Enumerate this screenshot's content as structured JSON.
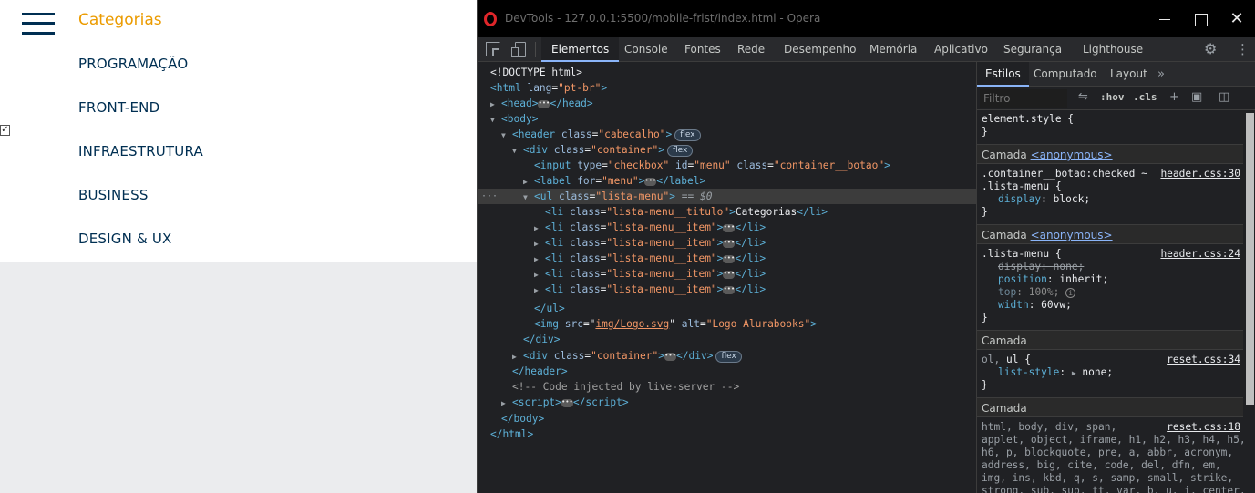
{
  "page": {
    "menu_title": "Categorias",
    "menu_items": [
      "PROGRAMAÇÃO",
      "FRONT-END",
      "INFRAESTRUTURA",
      "BUSINESS",
      "DESIGN & UX"
    ],
    "checkbox_checked": true,
    "colors": {
      "title": "#eb9b00",
      "item": "#002f52",
      "header_bg": "#ffffff",
      "body_bg": "#ebecee"
    }
  },
  "devtools": {
    "window_title": "DevTools - 127.0.0.1:5500/mobile-frist/index.html - Opera",
    "tabs": [
      "Elementos",
      "Console",
      "Fontes",
      "Rede",
      "Desempenho",
      "Memória",
      "Aplicativo",
      "Segurança",
      "Lighthouse"
    ],
    "active_tab": "Elementos",
    "icons": [
      "inspect-icon",
      "device-toolbar-icon",
      "settings-icon",
      "more-options-icon"
    ],
    "dom": {
      "doctype": "<!DOCTYPE html>",
      "html_tag": "html",
      "html_attr": "lang",
      "html_attr_val": "\"pt-br\"",
      "head": "head",
      "body": "body",
      "header_tag": "header",
      "header_class": "\"cabecalho\"",
      "badge_flex": "flex",
      "div_tag": "div",
      "container_class": "\"container\"",
      "input_tag": "input",
      "input_type_attr": "type",
      "input_type": "\"checkbox\"",
      "input_id_attr": "id",
      "input_id": "\"menu\"",
      "input_class": "\"container__botao\"",
      "label_tag": "label",
      "label_for_attr": "for",
      "label_for": "\"menu\"",
      "ul_tag": "ul",
      "ul_class": "\"lista-menu\"",
      "selected_marker": "==",
      "selected_var": "$0",
      "li_tag": "li",
      "li_title_class": "\"lista-menu__titulo\"",
      "li_title_text": "Categorias",
      "li_item_class": "\"lista-menu__item\"",
      "img_tag": "img",
      "img_src_attr": "src",
      "img_src": "img/Logo.svg",
      "img_alt_attr": "alt",
      "img_alt": "\"Logo Alurabooks\"",
      "comment": "<!-- Code injected by live-server -->",
      "script_tag": "script",
      "class_attr": "class"
    },
    "styles": {
      "tabs": [
        "Estilos",
        "Computado",
        "Layout"
      ],
      "active_tab": "Estilos",
      "more": "»",
      "filter_placeholder": "Filtro",
      "hov": ":hov",
      "cls": ".cls",
      "element_style": "element.style",
      "layer_label": "Camada",
      "layer_anonymous": "<anonymous>",
      "rule1_selector_a": ".container__botao:checked ~",
      "rule1_selector_b": ".lista-menu",
      "rule1_src": "header.css:30",
      "rule1_prop": "display",
      "rule1_val": "block;",
      "rule2_selector": ".lista-menu",
      "rule2_src": "header.css:24",
      "rule2_p1": "display",
      "rule2_v1": "none;",
      "rule2_p2": "position",
      "rule2_v2": "inherit;",
      "rule2_p3": "top",
      "rule2_v3": "100%;",
      "rule2_p4": "width",
      "rule2_v4": "60vw;",
      "rule3_selector_a": "ol,",
      "rule3_selector_b": "ul",
      "rule3_src": "reset.css:34",
      "rule3_prop": "list-style",
      "rule3_val": "none;",
      "rule4_src": "reset.css:18",
      "rule4_lines": [
        "html, body, div, span,",
        "applet, object, iframe, h1, h2, h3, h4, h5,",
        "h6, p, blockquote, pre, a, abbr, acronym,",
        "address, big, cite, code, del, dfn, em,",
        "img, ins, kbd, q, s, samp, small, strike,",
        "strong, sub, sup, tt, var, b, u, i, center,"
      ]
    }
  }
}
